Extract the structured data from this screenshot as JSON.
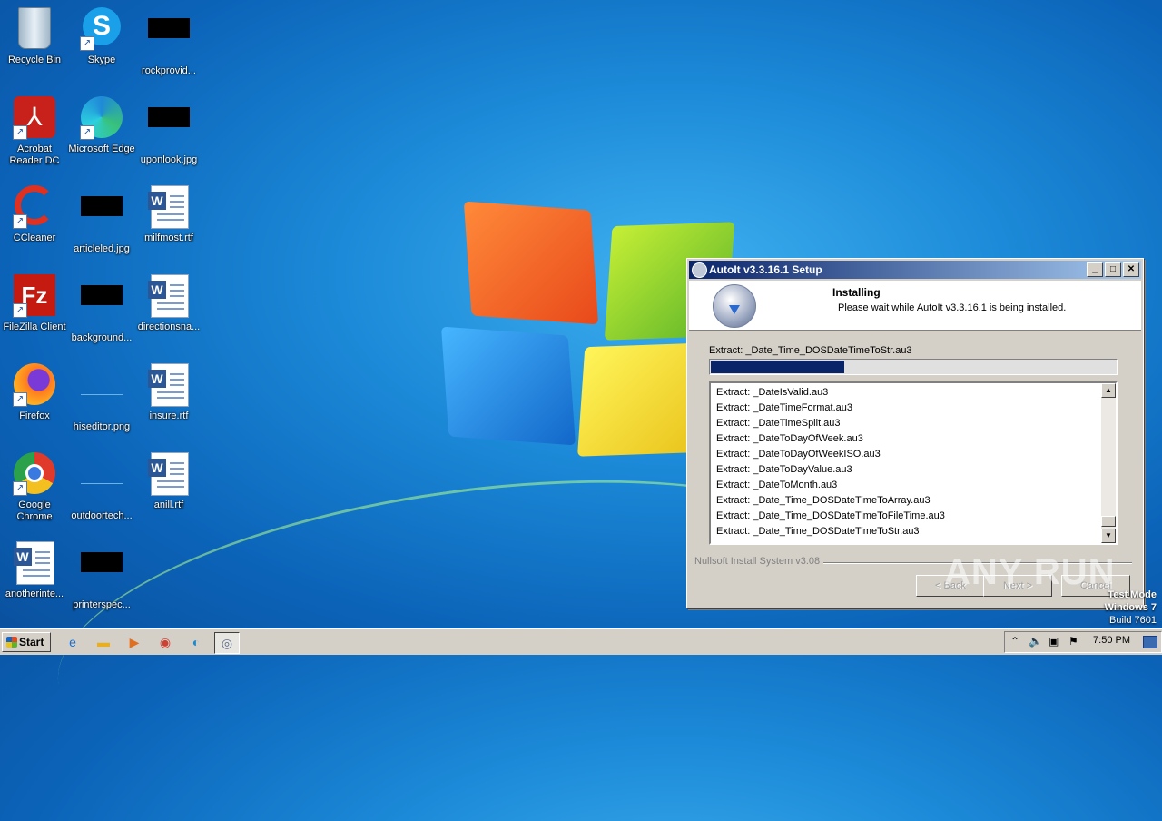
{
  "desktop": {
    "icons": [
      {
        "label": "Recycle Bin",
        "icon": "recycle-bin-icon"
      },
      {
        "label": "Skype",
        "icon": "skype-icon"
      },
      {
        "label": "rockprovid...",
        "icon": "image-file-icon"
      },
      {
        "label": "Acrobat Reader DC",
        "icon": "acrobat-icon"
      },
      {
        "label": "Microsoft Edge",
        "icon": "edge-icon"
      },
      {
        "label": "uponlook.jpg",
        "icon": "image-file-icon"
      },
      {
        "label": "CCleaner",
        "icon": "ccleaner-icon"
      },
      {
        "label": "articleled.jpg",
        "icon": "image-file-icon"
      },
      {
        "label": "milfmost.rtf",
        "icon": "word-document-icon"
      },
      {
        "label": "FileZilla Client",
        "icon": "filezilla-icon"
      },
      {
        "label": "background...",
        "icon": "image-file-icon"
      },
      {
        "label": "directionsna...",
        "icon": "word-document-icon"
      },
      {
        "label": "Firefox",
        "icon": "firefox-icon"
      },
      {
        "label": "hiseditor.png",
        "icon": "image-file-icon"
      },
      {
        "label": "insure.rtf",
        "icon": "word-document-icon"
      },
      {
        "label": "Google Chrome",
        "icon": "chrome-icon"
      },
      {
        "label": "outdoortech...",
        "icon": "image-file-icon"
      },
      {
        "label": "anill.rtf",
        "icon": "word-document-icon"
      },
      {
        "label": "anotherinte...",
        "icon": "word-document-icon"
      },
      {
        "label": "printerspec...",
        "icon": "image-file-icon"
      }
    ]
  },
  "dialog": {
    "title": "AutoIt v3.3.16.1 Setup",
    "header_title": "Installing",
    "header_subtitle": "Please wait while AutoIt v3.3.16.1 is being installed.",
    "status": "Extract: _Date_Time_DOSDateTimeToStr.au3",
    "progress": 0.33,
    "log_lines": [
      "Extract: _DateIsValid.au3",
      "Extract: _DateTimeFormat.au3",
      "Extract: _DateTimeSplit.au3",
      "Extract: _DateToDayOfWeek.au3",
      "Extract: _DateToDayOfWeekISO.au3",
      "Extract: _DateToDayValue.au3",
      "Extract: _DateToMonth.au3",
      "Extract: _Date_Time_DOSDateTimeToArray.au3",
      "Extract: _Date_Time_DOSDateTimeToFileTime.au3",
      "Extract: _Date_Time_DOSDateTimeToStr.au3"
    ],
    "footer_label": "Nullsoft Install System v3.08",
    "buttons": {
      "back": "< Back",
      "next": "Next >",
      "cancel": "Cancel"
    },
    "window_buttons": {
      "minimize": "_",
      "maximize": "□",
      "close": "✕"
    }
  },
  "watermark": "ANY RUN",
  "windows_info": {
    "line1": "Test Mode",
    "line2": "Windows 7",
    "line3": "Build 7601"
  },
  "taskbar": {
    "start_label": "Start",
    "apps": [
      "internet-explorer-icon",
      "explorer-folder-icon",
      "media-player-icon",
      "chrome-icon",
      "edge-icon",
      "autoit-setup-icon"
    ],
    "clock": "7:50 PM"
  }
}
